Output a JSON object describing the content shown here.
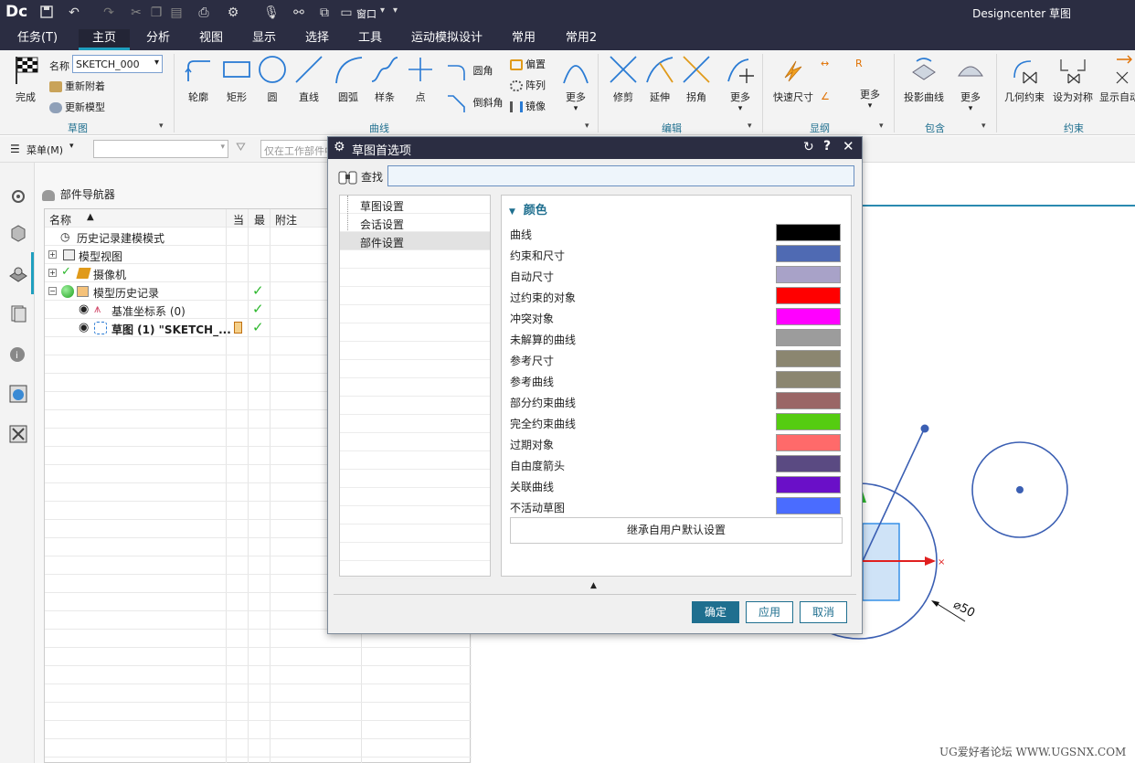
{
  "app": {
    "logo": "Dc",
    "title": "Designcenter 草图",
    "quick_access": {
      "window_label": "窗口"
    }
  },
  "menu_tabs": [
    {
      "label": "任务(T)",
      "active": false
    },
    {
      "label": "主页",
      "active": true
    },
    {
      "label": "分析",
      "active": false
    },
    {
      "label": "视图",
      "active": false
    },
    {
      "label": "显示",
      "active": false
    },
    {
      "label": "选择",
      "active": false
    },
    {
      "label": "工具",
      "active": false
    },
    {
      "label": "运动模拟设计",
      "active": false
    },
    {
      "label": "常用",
      "active": false
    },
    {
      "label": "常用2",
      "active": false
    }
  ],
  "ribbon": {
    "sketch_group": {
      "finish_label": "完成",
      "name_label": "名称",
      "name_value": "SKETCH_000",
      "reattach_label": "重新附着",
      "update_model_label": "更新模型",
      "group_label": "草图"
    },
    "curve_group": {
      "buttons": [
        "轮廓",
        "矩形",
        "圆",
        "直线",
        "圆弧",
        "样条",
        "点"
      ],
      "fillet_label": "圆角",
      "chamfer_label": "倒斜角",
      "offset_label": "偏置",
      "pattern_label": "阵列",
      "mirror_label": "镜像",
      "more_label": "更多",
      "group_label": "曲线"
    },
    "edit_group": {
      "buttons": [
        "修剪",
        "延伸",
        "拐角"
      ],
      "more_label": "更多",
      "group_label": "编辑"
    },
    "dim_group": {
      "quick_dim_label": "快速尺寸",
      "more_label": "更多",
      "group_label": "显纲"
    },
    "include_group": {
      "project_label": "投影曲线",
      "more_label": "更多",
      "group_label": "包含"
    },
    "constraint_group": {
      "buttons": [
        "几何约束",
        "设为对称",
        "显示自动"
      ],
      "group_label": "约束"
    }
  },
  "toolbar2": {
    "menu_label": "菜单(M)",
    "filter_placeholder": "仅在工作部件中"
  },
  "navigator": {
    "title": "部件导航器",
    "columns": [
      "名称",
      "当",
      "最",
      "附注"
    ],
    "rows": [
      {
        "label": "历史记录建模模式",
        "indent": 0,
        "current": false,
        "latest": false
      },
      {
        "label": "模型视图",
        "indent": 0,
        "current": false,
        "latest": false
      },
      {
        "label": "摄像机",
        "indent": 0,
        "current": false,
        "latest": false
      },
      {
        "label": "模型历史记录",
        "indent": 0,
        "current": false,
        "latest": true
      },
      {
        "label": "基准坐标系 (0)",
        "indent": 1,
        "current": false,
        "latest": true
      },
      {
        "label": "草图 (1) \"SKETCH_...",
        "indent": 1,
        "current": true,
        "latest": true
      }
    ]
  },
  "dialog": {
    "title": "草图首选项",
    "search_label": "查找",
    "search_value": "",
    "tree": [
      {
        "label": "草图设置",
        "selected": false
      },
      {
        "label": "会话设置",
        "selected": false
      },
      {
        "label": "部件设置",
        "selected": true
      }
    ],
    "section_title": "颜色",
    "colors": [
      {
        "label": "曲线",
        "color": "#000000"
      },
      {
        "label": "约束和尺寸",
        "color": "#4f6ab3"
      },
      {
        "label": "自动尺寸",
        "color": "#a8a2c8"
      },
      {
        "label": "过约束的对象",
        "color": "#ff0000"
      },
      {
        "label": "冲突对象",
        "color": "#ff00ff"
      },
      {
        "label": "未解算的曲线",
        "color": "#9c9c9c"
      },
      {
        "label": "参考尺寸",
        "color": "#8b8670"
      },
      {
        "label": "参考曲线",
        "color": "#8b8670"
      },
      {
        "label": "部分约束曲线",
        "color": "#9a6666"
      },
      {
        "label": "完全约束曲线",
        "color": "#55cc11"
      },
      {
        "label": "过期对象",
        "color": "#ff6a6a"
      },
      {
        "label": "自由度箭头",
        "color": "#5a4a82"
      },
      {
        "label": "关联曲线",
        "color": "#6a0fc8"
      },
      {
        "label": "不活动草图",
        "color": "#4a6cff"
      }
    ],
    "inherit_label": "继承自用户默认设置",
    "ok_label": "确定",
    "apply_label": "应用",
    "cancel_label": "取消"
  },
  "graphics": {
    "dimension_label": "⌀50"
  },
  "watermark": "UG爱好者论坛 WWW.UGSNX.COM"
}
